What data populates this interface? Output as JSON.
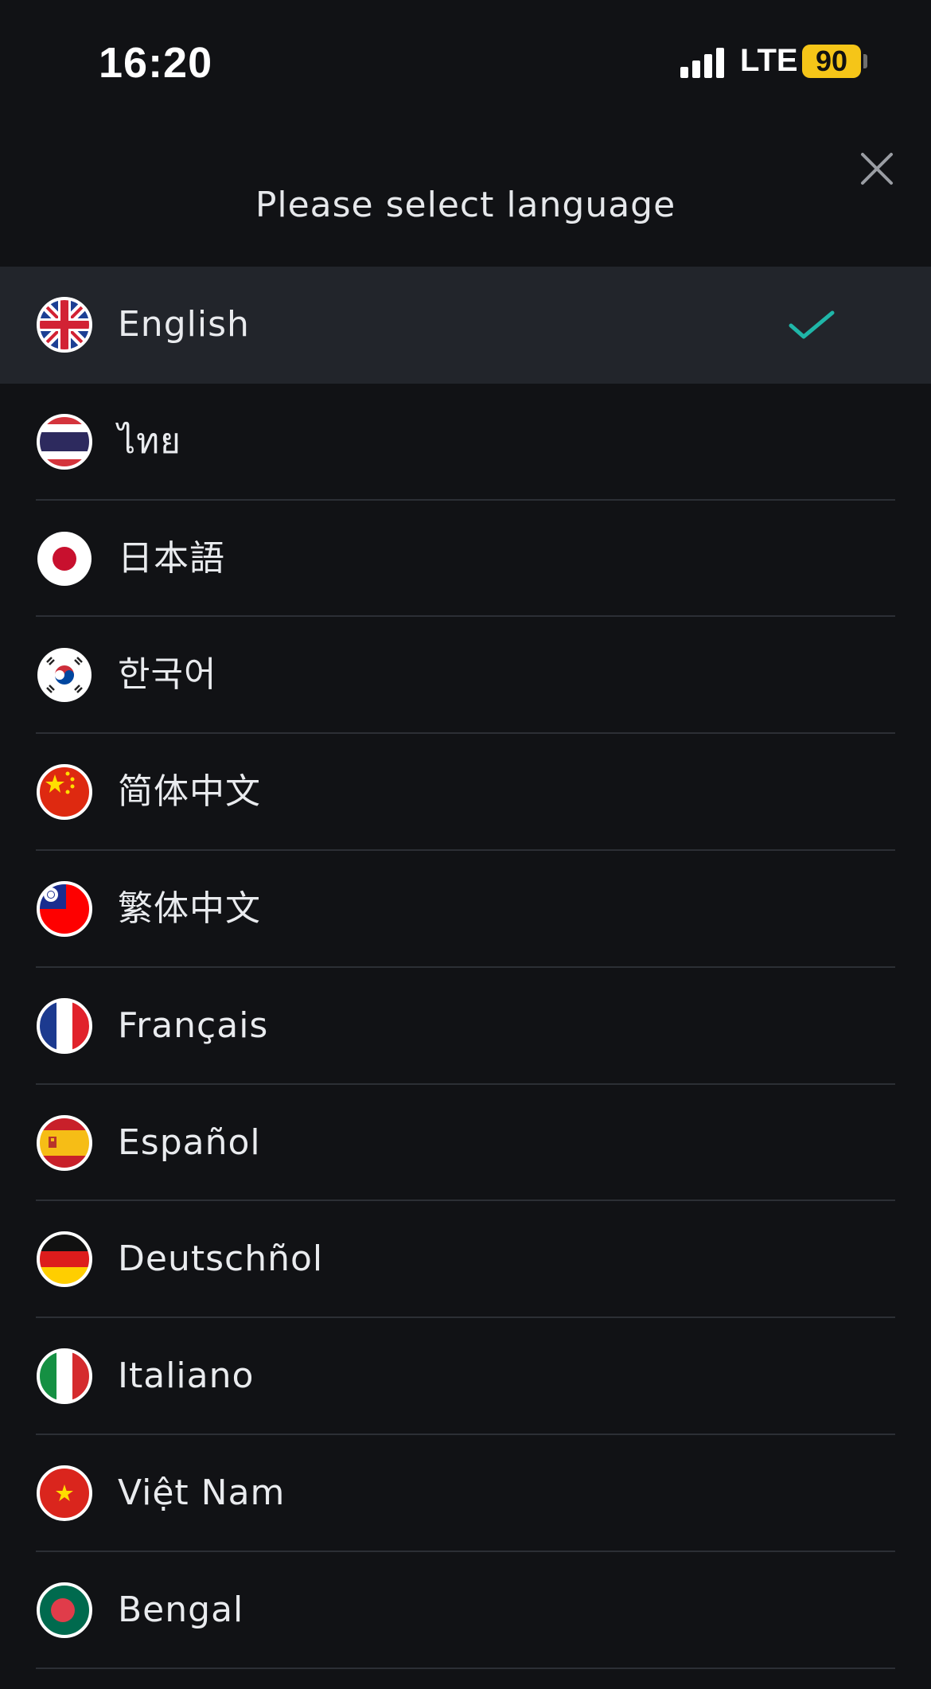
{
  "status_bar": {
    "time": "16:20",
    "network": "LTE",
    "battery": "90"
  },
  "header": {
    "title": "Please select language",
    "close_icon": "close-icon"
  },
  "colors": {
    "background": "#111215",
    "selected_row": "#22252b",
    "check": "#1fb6a8",
    "battery": "#f5c518"
  },
  "languages": [
    {
      "label": "English",
      "flag": "uk-flag-icon",
      "selected": true
    },
    {
      "label": "ไทย",
      "flag": "thailand-flag-icon",
      "selected": false
    },
    {
      "label": "日本語",
      "flag": "japan-flag-icon",
      "selected": false
    },
    {
      "label": "한국어",
      "flag": "korea-flag-icon",
      "selected": false
    },
    {
      "label": "简体中文",
      "flag": "china-flag-icon",
      "selected": false
    },
    {
      "label": "繁体中文",
      "flag": "taiwan-flag-icon",
      "selected": false
    },
    {
      "label": "Français",
      "flag": "france-flag-icon",
      "selected": false
    },
    {
      "label": "Español",
      "flag": "spain-flag-icon",
      "selected": false
    },
    {
      "label": "Deutschñol",
      "flag": "germany-flag-icon",
      "selected": false
    },
    {
      "label": "Italiano",
      "flag": "italy-flag-icon",
      "selected": false
    },
    {
      "label": "Việt Nam",
      "flag": "vietnam-flag-icon",
      "selected": false
    },
    {
      "label": "Bengal",
      "flag": "bangladesh-flag-icon",
      "selected": false
    }
  ]
}
